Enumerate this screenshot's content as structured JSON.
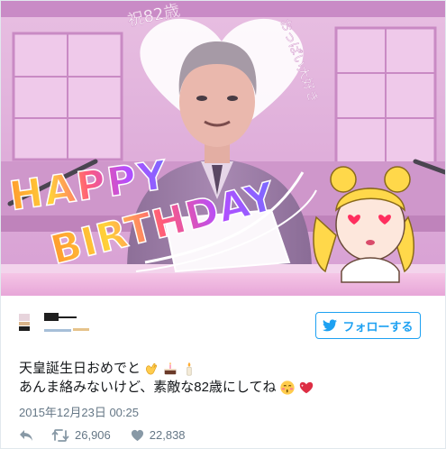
{
  "media": {
    "overlay_text": {
      "top_left": "祝82歳",
      "top_right": "おっぱい大好き",
      "happy": "HAPPY",
      "birthday": "BIRTHDAY"
    }
  },
  "author": {
    "avatar_colors": [
      "#e7d4dc",
      "#d9b48a",
      "#1f1f1f"
    ]
  },
  "follow_button": {
    "label": "フォローする",
    "icon": "twitter-bird-icon"
  },
  "tweet": {
    "line1": "天皇誕生日おめでと",
    "line1_emojis": [
      "clapping-hands-icon",
      "birthday-cake-icon",
      "candle-icon"
    ],
    "line2": "あんま絡みないけど、素敵な82歳にしてね",
    "line2_emojis": [
      "kissing-face-icon",
      "sparkling-heart-icon"
    ]
  },
  "timestamp": "2015年12月23日 00:25",
  "actions": {
    "reply": {
      "icon": "reply-icon"
    },
    "retweet": {
      "icon": "retweet-icon",
      "count": "26,906"
    },
    "like": {
      "icon": "heart-icon",
      "count": "22,838"
    }
  },
  "colors": {
    "accent": "#1da1f2",
    "text": "#14171a",
    "muted": "#657786",
    "border": "#e1e8ed"
  }
}
